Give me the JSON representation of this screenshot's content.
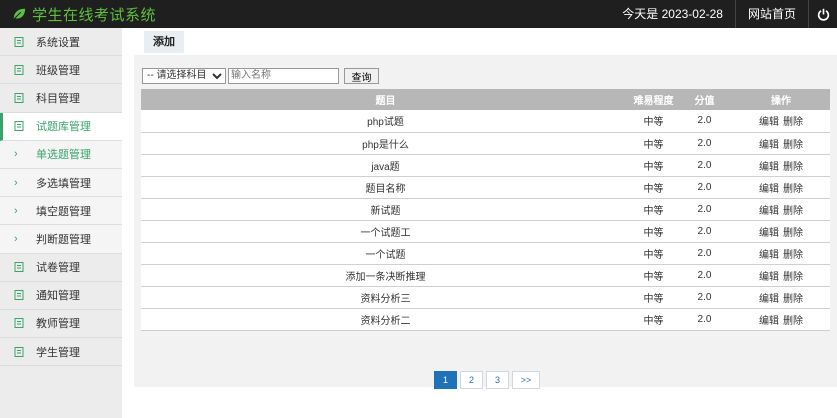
{
  "header": {
    "title": "学生在线考试系统",
    "date_text": "今天是 2023-02-28",
    "home_link": "网站首页",
    "brand_color": "#5fbf3c",
    "icons": {
      "logo": "leaf-icon",
      "power": "power-icon"
    }
  },
  "sidebar": {
    "items": [
      {
        "label": "系统设置"
      },
      {
        "label": "班级管理"
      },
      {
        "label": "科目管理"
      },
      {
        "label": "试题库管理",
        "active": true
      },
      {
        "label": "单选题管理",
        "sub": true,
        "current": true
      },
      {
        "label": "多选填管理",
        "sub": true
      },
      {
        "label": "填空题管理",
        "sub": true
      },
      {
        "label": "判断题管理",
        "sub": true
      },
      {
        "label": "试卷管理"
      },
      {
        "label": "通知管理"
      },
      {
        "label": "教师管理"
      },
      {
        "label": "学生管理"
      }
    ],
    "accent_color": "#3aa36a"
  },
  "main": {
    "tab_add": "添加",
    "filter": {
      "subject_select": "-- 请选择科目 --",
      "name_placeholder": "输入名称",
      "query_button": "查询"
    },
    "table": {
      "headers": [
        "题目",
        "难易程度",
        "分值",
        "操作"
      ],
      "rows": [
        {
          "title": "php试题",
          "level": "中等",
          "score": "2.0"
        },
        {
          "title": "php是什么",
          "level": "中等",
          "score": "2.0"
        },
        {
          "title": "java题",
          "level": "中等",
          "score": "2.0"
        },
        {
          "title": "题目名称",
          "level": "中等",
          "score": "2.0"
        },
        {
          "title": "新试题",
          "level": "中等",
          "score": "2.0"
        },
        {
          "title": "一个试题工",
          "level": "中等",
          "score": "2.0"
        },
        {
          "title": "一个试题",
          "level": "中等",
          "score": "2.0"
        },
        {
          "title": "添加一条决断推理",
          "level": "中等",
          "score": "2.0"
        },
        {
          "title": "资料分析三",
          "level": "中等",
          "score": "2.0"
        },
        {
          "title": "资料分析二",
          "level": "中等",
          "score": "2.0"
        }
      ],
      "edit_label": "编辑",
      "delete_label": "删除",
      "header_color": "#b7b7b7"
    },
    "pagination": {
      "pages": [
        "1",
        "2",
        "3"
      ],
      "next": ">>",
      "current": "1",
      "current_color": "#1e72b8"
    }
  }
}
